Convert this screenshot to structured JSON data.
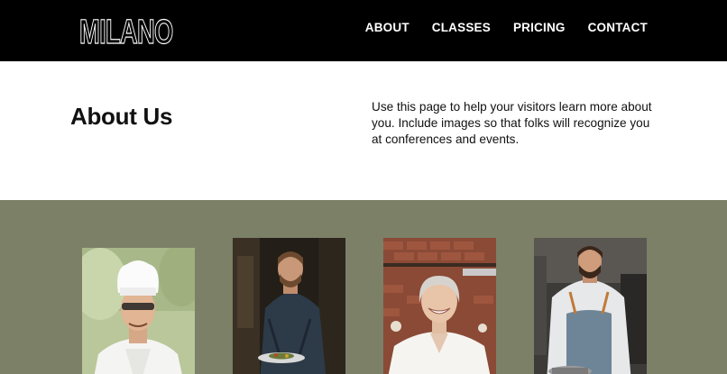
{
  "header": {
    "logo": "MILANO",
    "nav": [
      {
        "label": "ABOUT"
      },
      {
        "label": "CLASSES"
      },
      {
        "label": "PRICING"
      },
      {
        "label": "CONTACT"
      }
    ]
  },
  "intro": {
    "title": "About Us",
    "description": "Use this page to help your visitors learn more about you. Include images so that folks will recognize you at conferences and events."
  },
  "colors": {
    "header_bg": "#000000",
    "team_bg": "#7b8067"
  }
}
